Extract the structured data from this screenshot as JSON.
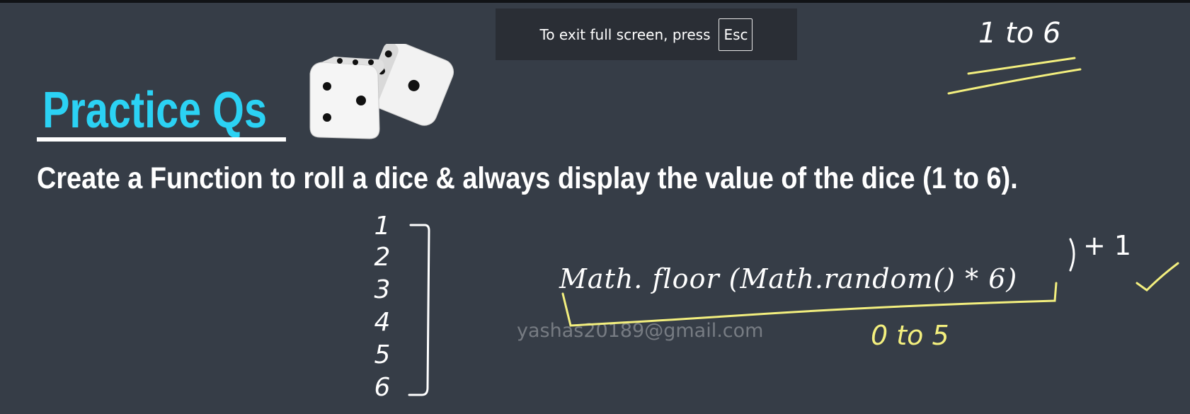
{
  "fullscreen_notice": {
    "text": "To exit full screen, press",
    "key": "Esc"
  },
  "slide": {
    "title": "Practice Qs",
    "question": "Create a Function to roll a dice & always display the value of the dice (1 to 6).",
    "dice_icon": "dice-icon"
  },
  "annotations": {
    "top_range": "1 to 6",
    "numbers": [
      "1",
      "2",
      "3",
      "4",
      "5",
      "6"
    ],
    "formula": "Math. floor (Math.random() * 6)",
    "plus_one": "+ 1",
    "inner_range": "0 to 5"
  },
  "watermark": {
    "email": "yashas20189@gmail.com"
  },
  "colors": {
    "background": "#363d47",
    "title": "#2bd2f4",
    "highlight": "#f3ef7e"
  }
}
